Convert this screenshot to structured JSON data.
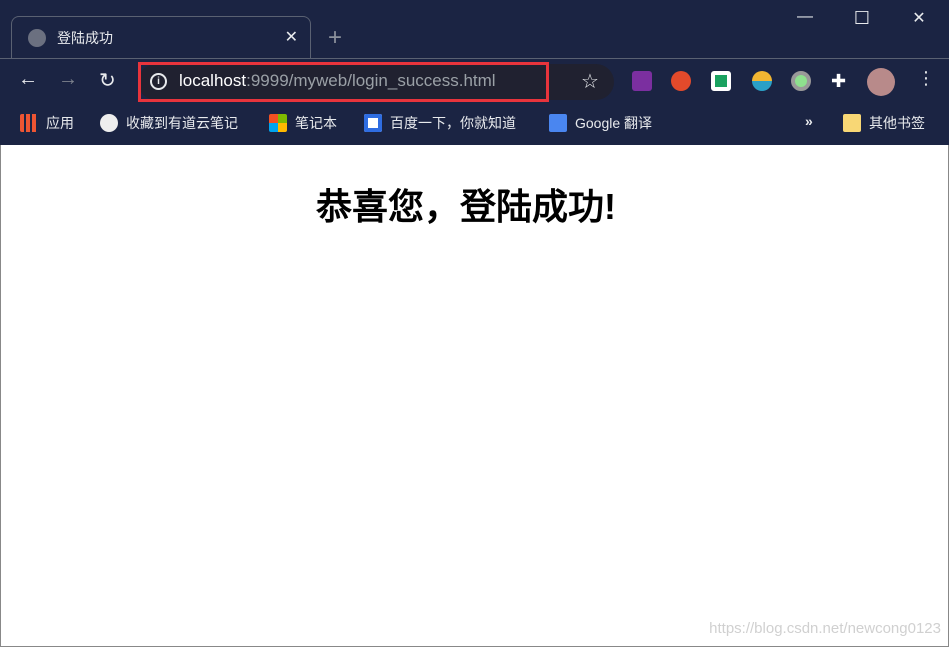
{
  "tab": {
    "title": "登陆成功",
    "close": "✕",
    "new_tab": "+"
  },
  "window": {
    "minimize": "—",
    "maximize": "☐",
    "close": "✕"
  },
  "nav": {
    "back": "←",
    "forward": "→",
    "reload": "↻"
  },
  "omnibox": {
    "host": "localhost",
    "path": ":9999/myweb/login_success.html",
    "star": "☆"
  },
  "extensions": [
    "onenote-icon",
    "infinity-icon",
    "chat-icon",
    "bowl-icon",
    "green-dot-icon",
    "puzzle-icon",
    "avatar"
  ],
  "bookmarks": [
    {
      "label": "应用"
    },
    {
      "label": "收藏到有道云笔记"
    },
    {
      "label": "笔记本"
    },
    {
      "label": "百度一下，你就知道"
    },
    {
      "label": "Google 翻译"
    }
  ],
  "bookmarks_more": "»",
  "other_bookmarks": "其他书签",
  "page": {
    "heading": "恭喜您，登陆成功!"
  },
  "watermark": "https://blog.csdn.net/newcong0123"
}
